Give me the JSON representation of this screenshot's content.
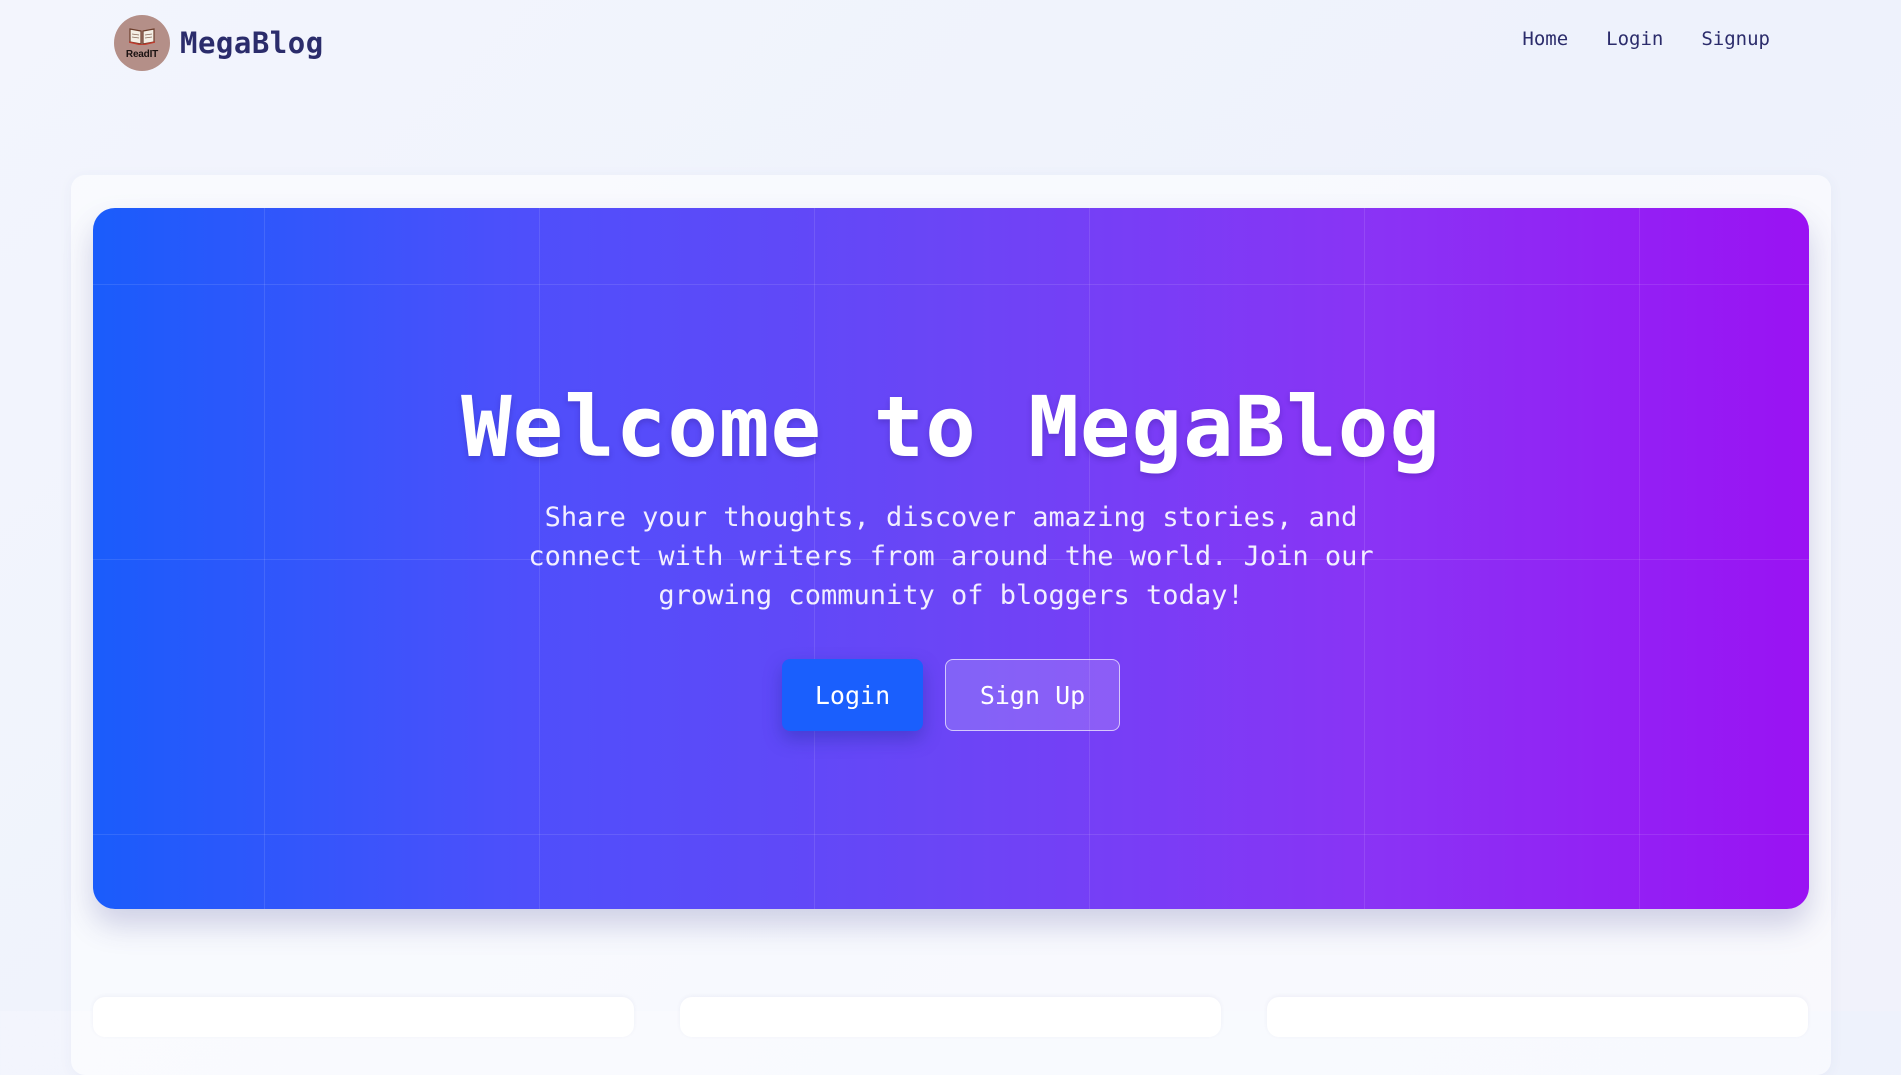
{
  "navbar": {
    "brand": {
      "logo_text": "ReadIT",
      "name": "MegaBlog"
    },
    "links": [
      {
        "label": "Home"
      },
      {
        "label": "Login"
      },
      {
        "label": "Signup"
      }
    ]
  },
  "hero": {
    "title": "Welcome to MegaBlog",
    "subtitle": "Share your thoughts, discover amazing stories, and connect with writers from around the world. Join our growing community of bloggers today!",
    "buttons": {
      "login_label": "Login",
      "signup_label": "Sign Up"
    }
  },
  "colors": {
    "brand_text": "#2b2c6b",
    "hero_gradient_start": "#1a5cfb",
    "hero_gradient_end": "#9a12f3",
    "login_button": "#1a5ffd"
  },
  "icons": {
    "logo": "book-icon"
  }
}
